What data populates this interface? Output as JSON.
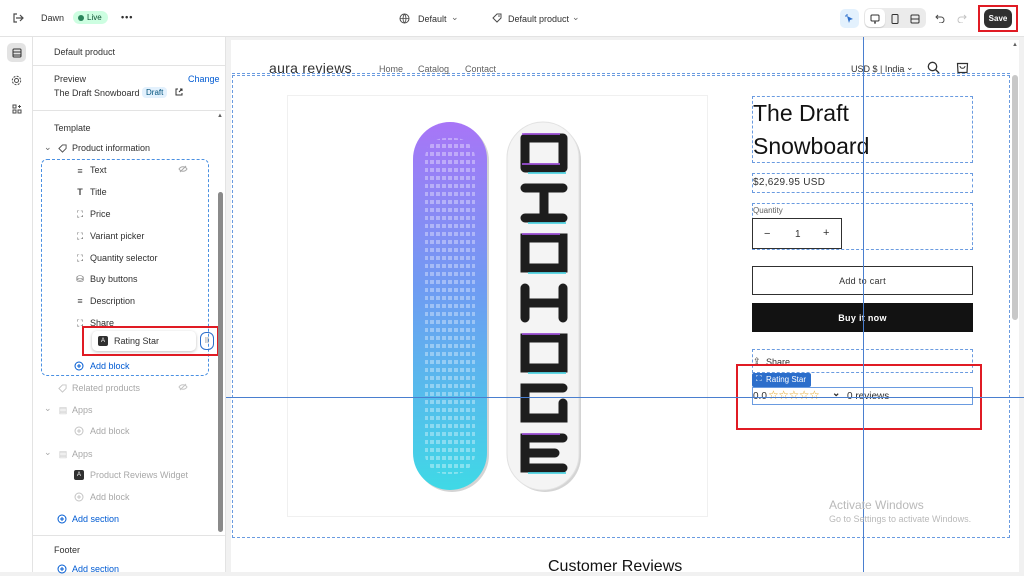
{
  "topbar": {
    "theme_name": "Dawn",
    "status_badge": "Live",
    "more_label": "•••",
    "template_select": "Default",
    "product_select": "Default product",
    "save_label": "Save"
  },
  "sidebar": {
    "header": "Default product",
    "preview_label": "Preview",
    "change_link": "Change",
    "preview_product": "The Draft Snowboard",
    "draft_badge": "Draft",
    "template_label": "Template",
    "section_product_info": "Product information",
    "blocks": [
      {
        "label": "Text",
        "icon": "text-lines-icon"
      },
      {
        "label": "Title",
        "icon": "title-icon"
      },
      {
        "label": "Price",
        "icon": "frame-icon"
      },
      {
        "label": "Variant picker",
        "icon": "frame-icon"
      },
      {
        "label": "Quantity selector",
        "icon": "frame-icon"
      },
      {
        "label": "Buy buttons",
        "icon": "buy-buttons-icon"
      },
      {
        "label": "Description",
        "icon": "text-lines-icon"
      },
      {
        "label": "Share",
        "icon": "frame-icon"
      }
    ],
    "dragging_block": "Rating Star",
    "add_block": "Add block",
    "related_products": "Related products",
    "apps_1": "Apps",
    "apps_1_add_block": "Add block",
    "apps_2": "Apps",
    "product_reviews_widget": "Product Reviews Widget",
    "apps_2_add_block": "Add block",
    "add_section": "Add section",
    "footer_label": "Footer",
    "footer_add_section": "Add section"
  },
  "store": {
    "brand": "aura reviews",
    "nav": [
      "Home",
      "Catalog",
      "Contact"
    ],
    "currency": "USD $ | India",
    "product_title_line1": "The Draft",
    "product_title_line2": "Snowboard",
    "price": "$2,629.95 USD",
    "quantity_label": "Quantity",
    "quantity_value": "1",
    "qty_minus": "−",
    "qty_plus": "+",
    "add_to_cart": "Add to cart",
    "buy_it_now": "Buy it now",
    "share": "Share",
    "rating_badge": "Rating Star",
    "rating_value": "0.0",
    "rating_stars": "☆☆☆☆☆",
    "rating_stars_filled": 0,
    "reviews_count": "0 reviews",
    "customer_reviews_heading": "Customer Reviews",
    "watermark_line1": "Activate Windows",
    "watermark_line2": "Go to Settings to activate Windows."
  },
  "colors": {
    "accent_blue": "#2c6ecb",
    "annotation_red": "#e01b24",
    "star_color": "#e5a21b",
    "board1_top": "#9b59f5",
    "board1_bottom": "#3fd0e0",
    "board2_letters": "#1d1d1d"
  }
}
